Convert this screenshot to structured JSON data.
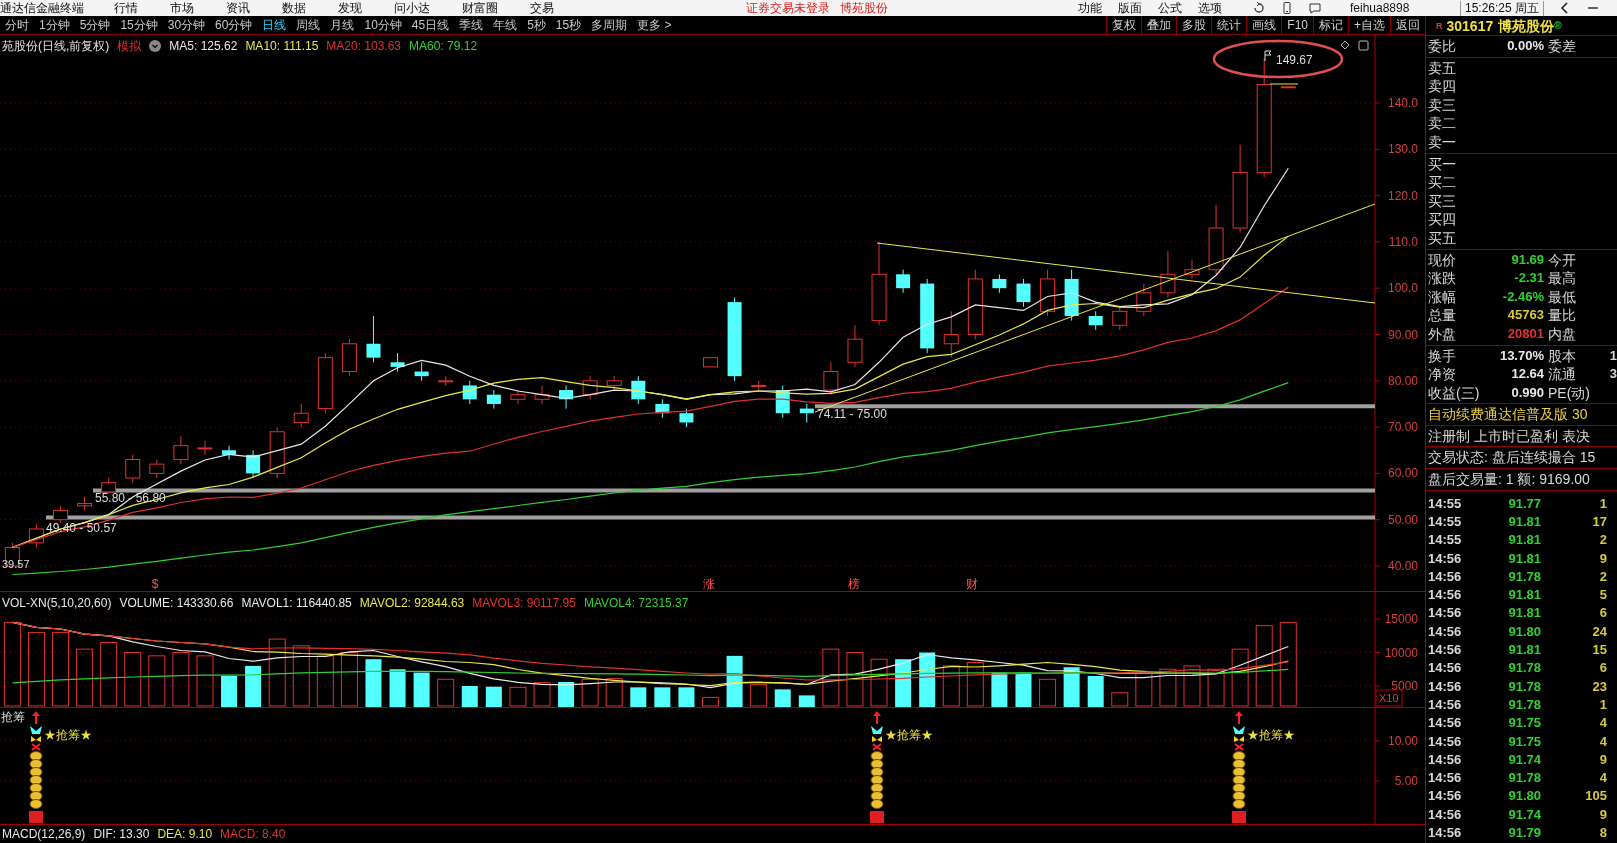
{
  "menu_bar": {
    "app_title": "通达信金融终端",
    "menus": [
      "行情",
      "市场",
      "资讯",
      "数据",
      "发现",
      "问小达",
      "财富圈",
      "交易"
    ],
    "login_notice": "证券交易未登录",
    "stock_name": "博苑股份",
    "tools": [
      "功能",
      "版面",
      "公式",
      "选项"
    ],
    "user": "feihua8898",
    "clock": "15:26:25 周五"
  },
  "period_tabs": [
    {
      "label": "分时",
      "selected": false
    },
    {
      "label": "1分钟",
      "selected": false
    },
    {
      "label": "5分钟",
      "selected": false
    },
    {
      "label": "15分钟",
      "selected": false
    },
    {
      "label": "30分钟",
      "selected": false
    },
    {
      "label": "60分钟",
      "selected": false
    },
    {
      "label": "日线",
      "selected": true
    },
    {
      "label": "周线",
      "selected": false
    },
    {
      "label": "月线",
      "selected": false
    },
    {
      "label": "10分钟",
      "selected": false
    },
    {
      "label": "45日线",
      "selected": false
    },
    {
      "label": "季线",
      "selected": false
    },
    {
      "label": "年线",
      "selected": false
    },
    {
      "label": "5秒",
      "selected": false
    },
    {
      "label": "15秒",
      "selected": false
    },
    {
      "label": "多周期",
      "selected": false
    },
    {
      "label": "更多 >",
      "selected": false
    }
  ],
  "toolbar_buttons": [
    "复权",
    "叠加",
    "多股",
    "统计",
    "画线",
    "F10",
    "标记",
    "+自选",
    "返回"
  ],
  "main_chart": {
    "title": "苑股份(日线,前复权)",
    "mode": "模拟",
    "indicators": [
      {
        "label": "MA5: 125.62",
        "color": "#e8e8e8"
      },
      {
        "label": "MA10: 111.15",
        "color": "#e8e84a"
      },
      {
        "label": "MA20: 103.63",
        "color": "#e03030"
      },
      {
        "label": "MA60: 79.12",
        "color": "#30d030"
      }
    ],
    "yticks": [
      "140.0",
      "130.0",
      "120.0",
      "110.0",
      "100.0",
      "90.00",
      "80.00",
      "70.00",
      "60.00",
      "50.00",
      "40.00"
    ],
    "high_label": "149.67",
    "range_labels": [
      "74.11 - 75.00",
      "55.80 - 56.80",
      "49.40 - 50.57"
    ],
    "low_label": "39.57",
    "markers": [
      "$",
      "涨",
      "榜",
      "财"
    ]
  },
  "volume_panel": {
    "legend": [
      {
        "label": "VOL-XN(5,10,20,60)",
        "color": "#e8e8e8"
      },
      {
        "label": "VOLUME: 143330.66",
        "color": "#e8e8e8"
      },
      {
        "label": "MAVOL1: 116440.85",
        "color": "#e8e8e8"
      },
      {
        "label": "MAVOL2: 92844.63",
        "color": "#e8e84a"
      },
      {
        "label": "MAVOL3: 90117.95",
        "color": "#e03030"
      },
      {
        "label": "MAVOL4: 72315.37",
        "color": "#30d030"
      }
    ],
    "yticks": [
      "15000",
      "10000",
      "5000"
    ],
    "unit": "X10"
  },
  "signal_panel": {
    "title": "抢筹",
    "signals": [
      "★抢筹★",
      "★抢筹★",
      "★抢筹★"
    ],
    "yticks": [
      "10.00",
      "5.00"
    ]
  },
  "macd_panel": {
    "legend": [
      {
        "label": "MACD(12,26,9)",
        "color": "#e8e8e8"
      },
      {
        "label": "DIF: 13.30",
        "color": "#e8e8e8"
      },
      {
        "label": "DEA: 9.10",
        "color": "#e8e84a"
      },
      {
        "label": "MACD: 8.40",
        "color": "#e03030"
      }
    ]
  },
  "quote_panel": {
    "market_badge": "R",
    "code": "301617",
    "name": "博苑股份",
    "name_mark": "®",
    "ratio": {
      "label": "委比",
      "value": "0.00%",
      "label2": "委差"
    },
    "asks": [
      "卖五",
      "卖四",
      "卖三",
      "卖二",
      "卖一"
    ],
    "bids": [
      "买一",
      "买二",
      "买三",
      "买四",
      "买五"
    ],
    "stats": [
      {
        "label": "现价",
        "value": "91.69",
        "label2": "今开",
        "color": "#30d030"
      },
      {
        "label": "涨跌",
        "value": "-2.31",
        "label2": "最高",
        "color": "#30d030"
      },
      {
        "label": "涨幅",
        "value": "-2.46%",
        "label2": "最低",
        "color": "#30d030"
      },
      {
        "label": "总量",
        "value": "45763",
        "label2": "量比",
        "color": "#d8c83a"
      },
      {
        "label": "外盘",
        "value": "20801",
        "label2": "内盘",
        "color": "#e03030"
      }
    ],
    "fundamentals": [
      {
        "label": "换手",
        "value": "13.70%",
        "label2": "股本",
        "value2": "1"
      },
      {
        "label": "净资",
        "value": "12.64",
        "label2": "流通",
        "value2": "3"
      },
      {
        "label": "收益(三)",
        "value": "0.990",
        "label2": "PE(动)"
      }
    ],
    "promo": "自动续费通达信普及版  30",
    "info_lines": [
      "注册制 上市时已盈利 表决",
      "交易状态: 盘后连续撮合 15",
      "盘后交易量: 1  额: 9169.00"
    ],
    "ticks": [
      {
        "time": "14:55",
        "price": "91.77",
        "volume": "1"
      },
      {
        "time": "14:55",
        "price": "91.81",
        "volume": "17"
      },
      {
        "time": "14:55",
        "price": "91.81",
        "volume": "2"
      },
      {
        "time": "14:56",
        "price": "91.81",
        "volume": "9"
      },
      {
        "time": "14:56",
        "price": "91.78",
        "volume": "2"
      },
      {
        "time": "14:56",
        "price": "91.81",
        "volume": "5"
      },
      {
        "time": "14:56",
        "price": "91.81",
        "volume": "6"
      },
      {
        "time": "14:56",
        "price": "91.80",
        "volume": "24"
      },
      {
        "time": "14:56",
        "price": "91.81",
        "volume": "15"
      },
      {
        "time": "14:56",
        "price": "91.78",
        "volume": "6"
      },
      {
        "time": "14:56",
        "price": "91.78",
        "volume": "23"
      },
      {
        "time": "14:56",
        "price": "91.78",
        "volume": "1"
      },
      {
        "time": "14:56",
        "price": "91.75",
        "volume": "4"
      },
      {
        "time": "14:56",
        "price": "91.75",
        "volume": "4"
      },
      {
        "time": "14:56",
        "price": "91.74",
        "volume": "9"
      },
      {
        "time": "14:56",
        "price": "91.78",
        "volume": "4"
      },
      {
        "time": "14:56",
        "price": "91.80",
        "volume": "105"
      },
      {
        "time": "14:56",
        "price": "91.74",
        "volume": "9"
      },
      {
        "time": "14:56",
        "price": "91.79",
        "volume": "8"
      }
    ]
  }
}
